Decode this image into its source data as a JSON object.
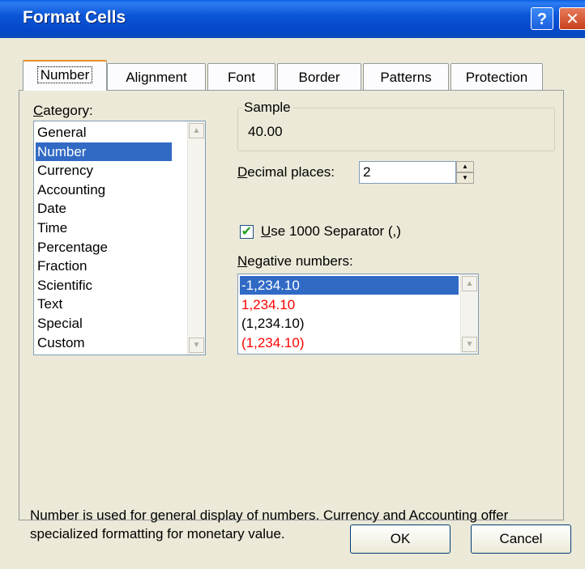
{
  "window": {
    "title": "Format Cells"
  },
  "tabs": [
    "Number",
    "Alignment",
    "Font",
    "Border",
    "Patterns",
    "Protection"
  ],
  "category": {
    "label": "Category:",
    "items": [
      "General",
      "Number",
      "Currency",
      "Accounting",
      "Date",
      "Time",
      "Percentage",
      "Fraction",
      "Scientific",
      "Text",
      "Special",
      "Custom"
    ],
    "selected": "Number"
  },
  "sample": {
    "label": "Sample",
    "value": "40.00"
  },
  "decimal": {
    "label": "Decimal places:",
    "value": "2"
  },
  "separator": {
    "label": "Use 1000 Separator (,)",
    "checked": true
  },
  "negative": {
    "label": "Negative numbers:",
    "items": [
      {
        "text": "-1,234.10",
        "color": "#000000",
        "selected": true
      },
      {
        "text": "1,234.10",
        "color": "#ff0000",
        "selected": false
      },
      {
        "text": "(1,234.10)",
        "color": "#000000",
        "selected": false
      },
      {
        "text": "(1,234.10)",
        "color": "#ff0000",
        "selected": false
      }
    ]
  },
  "description": "Number is used for general display of numbers.  Currency and Accounting offer specialized formatting for monetary value.",
  "buttons": {
    "ok": "OK",
    "cancel": "Cancel"
  }
}
